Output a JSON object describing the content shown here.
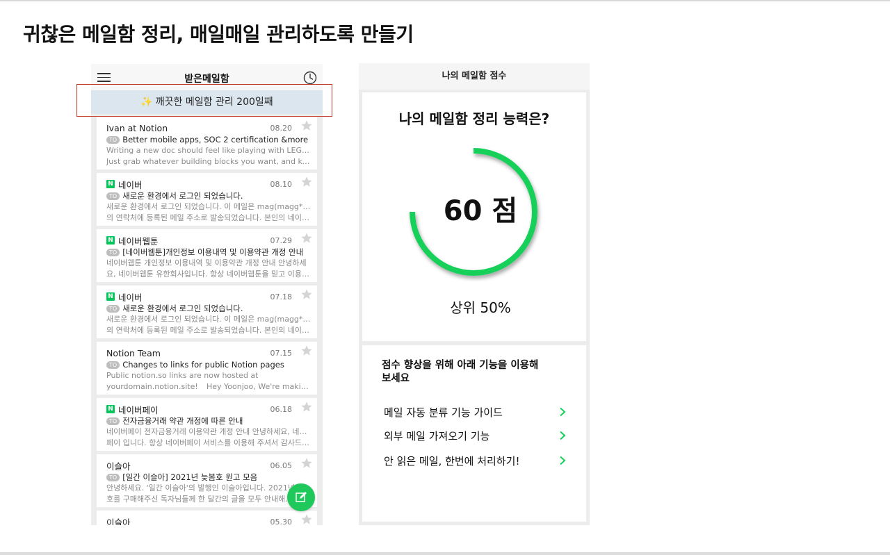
{
  "page": {
    "headline": "귀찮은 메일함 정리, 매일매일 관리하도록 만들기"
  },
  "inbox": {
    "title": "받은메일함",
    "banner_icon": "✨",
    "banner_text": "깨끗한 메일함 관리 200일째",
    "compose_icon": "compose-icon",
    "to_label": "TO",
    "n_label": "N",
    "mails": [
      {
        "sender": "Ivan at Notion",
        "naver": false,
        "date": "08.20",
        "subject": "Better mobile apps, SOC 2 certification &more",
        "preview1": "Writing a new doc should feel like playing with LEGOs.",
        "preview2": "Just grab whatever building blocks you want, and kee…"
      },
      {
        "sender": "네이버",
        "naver": true,
        "date": "08.10",
        "subject": "새로운 환경에서 로그인 되었습니다.",
        "preview1": "새로운 환경에서 로그인 되었습니다. 이 메일은 mag(magg****)",
        "preview2": "의 연락처에 등록된 메일 주소로 발송되었습니다. 본인의 네이…"
      },
      {
        "sender": "네이버웹툰",
        "naver": true,
        "date": "07.29",
        "subject": "[네이버웹툰]개인정보 이용내역 및 이용약관 개정 안내",
        "preview1": "네이버웹툰 개인정보 이용내역 및 이용약관 개정 안내 안녕하세",
        "preview2": "요, 네이버웹툰 유한회사입니다. 항상 네이버웹툰을 믿고 이용…"
      },
      {
        "sender": "네이버",
        "naver": true,
        "date": "07.18",
        "subject": "새로운 환경에서 로그인 되었습니다.",
        "preview1": "새로운 환경에서 로그인 되었습니다. 이 메일은 mag(magg****)",
        "preview2": "의 연락처에 등록된 메일 주소로 발송되었습니다. 본인의 네이…"
      },
      {
        "sender": "Notion Team",
        "naver": false,
        "date": "07.15",
        "subject": "Changes to links for public Notion pages",
        "preview1": "Public notion.so links are now hosted at",
        "preview2": "yourdomain.notion.site!",
        "preview2b": "Hey Yoonjoo, We're maki…"
      },
      {
        "sender": "네이버페이",
        "naver": true,
        "date": "06.18",
        "subject": "전자금융거래 약관 개정에 따른 안내",
        "preview1": "네이버페이 전자금융거래 이용약관 개정 안내 안녕하세요, 네이버",
        "preview2": "페이 입니다. 항상 네이버페이 서비스를 이용해 주셔서 감사드…"
      },
      {
        "sender": "이슬아",
        "naver": false,
        "date": "06.05",
        "subject": "[일간 이슬아] 2021년 늦봄호 원고 모음",
        "preview1": "안녕하세요. '일간 이슬아'의 발행인 이슬아입니다. 2021년 …",
        "preview2": "호를 구매해주신 독자님들께 한 달간의 글을 모두 안내해…"
      },
      {
        "sender": "이슬아",
        "naver": false,
        "date": "05.30",
        "subject": "",
        "preview1": "",
        "preview2": ""
      }
    ]
  },
  "score": {
    "header": "나의 메일함 점수",
    "question": "나의 메일함 정리 능력은?",
    "value_text": "60 점",
    "progress_fraction": 0.75,
    "rank_text": "상위 50%",
    "accent_color": "#15d05a"
  },
  "tips": {
    "title": "점수 향상을 위해 아래 기능을 이용해보세요",
    "items": [
      {
        "label": "메일 자동 분류 기능 가이드"
      },
      {
        "label": "외부 메일 가져오기 기능"
      },
      {
        "label": "안 읽은 메일, 한번에 처리하기!"
      }
    ]
  }
}
